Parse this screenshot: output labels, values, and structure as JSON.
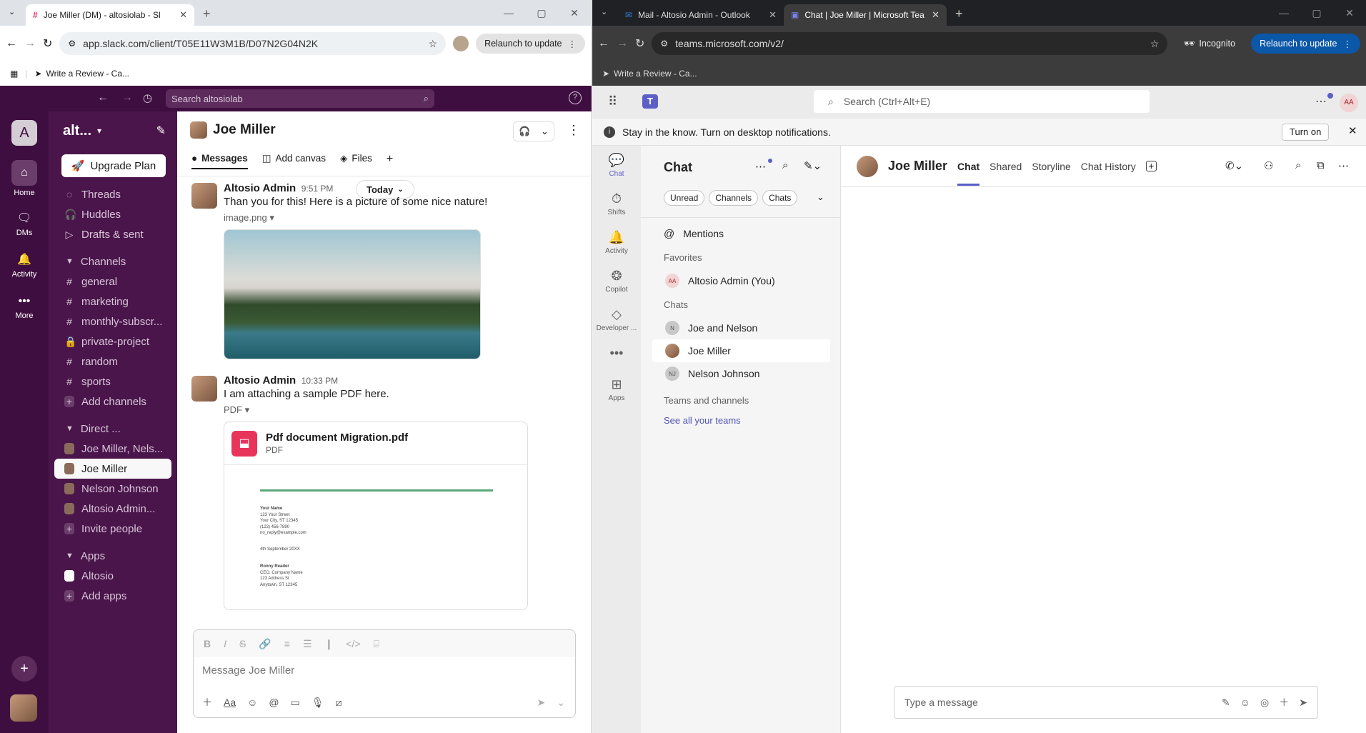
{
  "left_browser": {
    "tab_title": "Joe Miller (DM) - altosiolab - Sl",
    "url": "app.slack.com/client/T05E11W3M1B/D07N2G04N2K",
    "relaunch": "Relaunch to update",
    "bookmark": "Write a Review - Ca..."
  },
  "slack": {
    "search_placeholder": "Search altosiolab",
    "workspace_initial": "A",
    "workspace_name": "alt...",
    "rail": {
      "home": "Home",
      "dms": "DMs",
      "activity": "Activity",
      "more": "More"
    },
    "upgrade": "Upgrade Plan",
    "nav": [
      "Threads",
      "Huddles",
      "Drafts & sent"
    ],
    "channels_header": "Channels",
    "channels": [
      "general",
      "marketing",
      "monthly-subscr...",
      "private-project",
      "random",
      "sports"
    ],
    "add_channels": "Add channels",
    "direct_header": "Direct ...",
    "dms": [
      "Joe Miller, Nels...",
      "Joe Miller",
      "Nelson Johnson",
      "Altosio Admin..."
    ],
    "invite": "Invite people",
    "apps_header": "Apps",
    "apps": [
      "Altosio"
    ],
    "add_apps": "Add apps",
    "channel_title": "Joe Miller",
    "tabs": [
      "Messages",
      "Add canvas",
      "Files"
    ],
    "date_pill": "Today",
    "messages": [
      {
        "author": "Altosio Admin",
        "time": "9:51 PM",
        "text": "Than you for this! Here is a picture of some nice nature!",
        "attachment_label": "image.png"
      },
      {
        "author": "Altosio Admin",
        "time": "10:33 PM",
        "text": "I am attaching a sample PDF here.",
        "attachment_label": "PDF",
        "file_name": "Pdf document Migration.pdf",
        "file_type": "PDF"
      }
    ],
    "pdf_preview": {
      "name": "Your Name",
      "lines": [
        "123 Your Street",
        "Your City, ST 12345",
        "(123) 456-7890",
        "no_reply@example.com"
      ],
      "date": "4th September 20XX",
      "recipient": "Ronny Reader",
      "recipient_lines": [
        "CEO, Company Name",
        "123 Address St",
        "Anytown, ST 12345"
      ]
    },
    "composer_placeholder": "Message Joe Miller"
  },
  "right_browser": {
    "tabs": [
      "Mail - Altosio Admin - Outlook",
      "Chat | Joe Miller | Microsoft Tea"
    ],
    "url": "teams.microsoft.com/v2/",
    "incognito": "Incognito",
    "relaunch": "Relaunch to update",
    "bookmark": "Write a Review - Ca..."
  },
  "teams": {
    "search_placeholder": "Search (Ctrl+Alt+E)",
    "avatar": "AA",
    "banner_text": "Stay in the know. Turn on desktop notifications.",
    "banner_button": "Turn on",
    "rail": [
      "Chat",
      "Shifts",
      "Activity",
      "Copilot",
      "Developer ...",
      "Apps"
    ],
    "list_title": "Chat",
    "filters": [
      "Unread",
      "Channels",
      "Chats"
    ],
    "mentions": "Mentions",
    "favorites_header": "Favorites",
    "favorites": [
      {
        "name": "Altosio Admin (You)",
        "initials": "AA"
      }
    ],
    "chats_header": "Chats",
    "chats": [
      {
        "name": "Joe and Nelson",
        "initials": "N"
      },
      {
        "name": "Joe Miller",
        "initials": ""
      },
      {
        "name": "Nelson Johnson",
        "initials": "NJ"
      }
    ],
    "teams_header": "Teams and channels",
    "see_all": "See all your teams",
    "chat_name": "Joe Miller",
    "chat_tabs": [
      "Chat",
      "Shared",
      "Storyline",
      "Chat History"
    ],
    "composer_placeholder": "Type a message"
  },
  "colors": {
    "slack_aubergine": "#4a154b",
    "teams_accent": "#5b5fc7",
    "teams_link": "#4f52b2"
  }
}
